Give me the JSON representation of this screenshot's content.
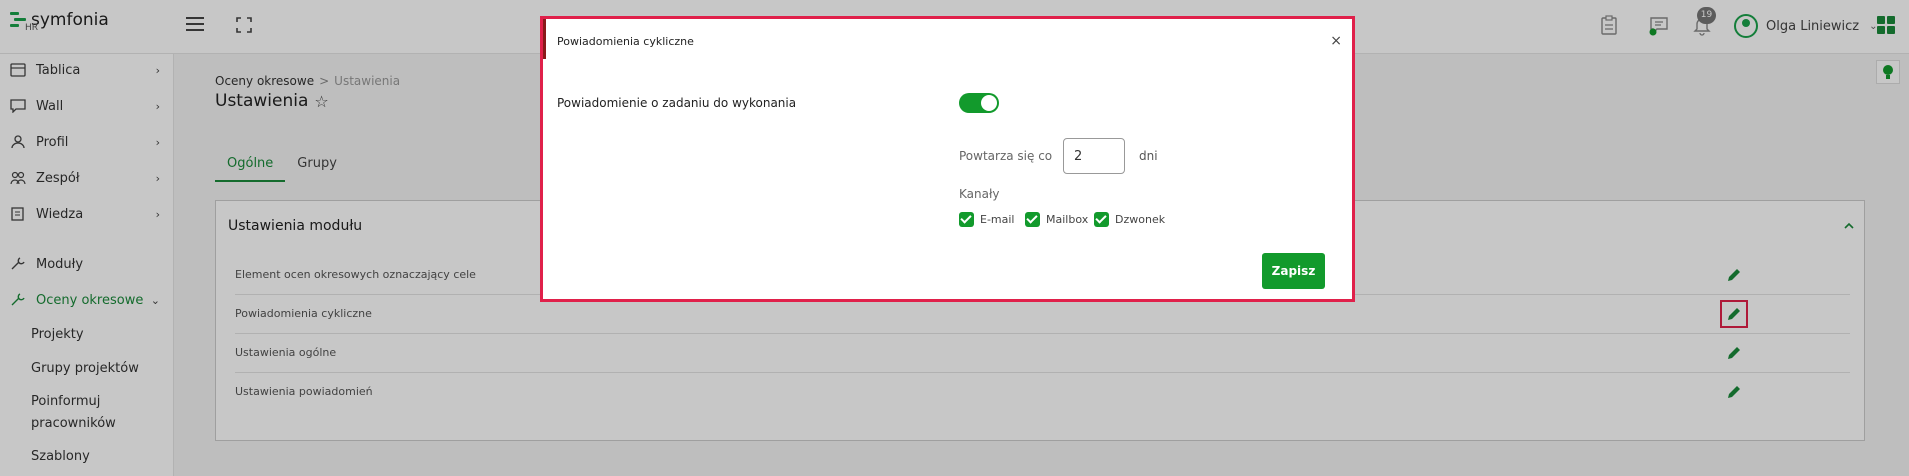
{
  "header": {
    "brand": "symfonia",
    "brand_sub": "HR",
    "notification_count": "19",
    "user_name": "Olga Liniewicz"
  },
  "sidebar": {
    "items": [
      {
        "label": "Tablica",
        "icon": "dashboard-icon",
        "chevron": "›"
      },
      {
        "label": "Wall",
        "icon": "chat-icon",
        "chevron": "›"
      },
      {
        "label": "Profil",
        "icon": "user-icon",
        "chevron": "›"
      },
      {
        "label": "Zespół",
        "icon": "team-icon",
        "chevron": "›"
      },
      {
        "label": "Wiedza",
        "icon": "book-icon",
        "chevron": "›"
      },
      {
        "label": "Moduły",
        "icon": "wrench-icon"
      },
      {
        "label": "Oceny okresowe",
        "icon": "wrench-icon",
        "chevron": "⌄"
      }
    ],
    "subitems": [
      "Projekty",
      "Grupy projektów",
      "Poinformuj",
      "pracowników",
      "Szablony"
    ]
  },
  "breadcrumb": {
    "parent": "Oceny okresowe",
    "separator": ">",
    "current": "Ustawienia"
  },
  "page_title": "Ustawienia",
  "tabs": [
    "Ogólne",
    "Grupy"
  ],
  "panel": {
    "title": "Ustawienia modułu",
    "rows": [
      "Element ocen okresowych oznaczający cele",
      "Powiadomienia cykliczne",
      "Ustawienia ogólne",
      "Ustawienia powiadomień"
    ]
  },
  "modal": {
    "title": "Powiadomienia cykliczne",
    "close": "×",
    "field_label": "Powiadomienie o zadaniu do wykonania",
    "toggle_on": true,
    "repeat_label": "Powtarza się co",
    "repeat_value": "2",
    "repeat_unit": "dni",
    "channels_label": "Kanały",
    "channels": [
      "E-mail",
      "Mailbox",
      "Dzwonek"
    ],
    "save_label": "Zapisz"
  },
  "colors": {
    "accent": "#129a2c",
    "highlight": "#e0204a"
  }
}
